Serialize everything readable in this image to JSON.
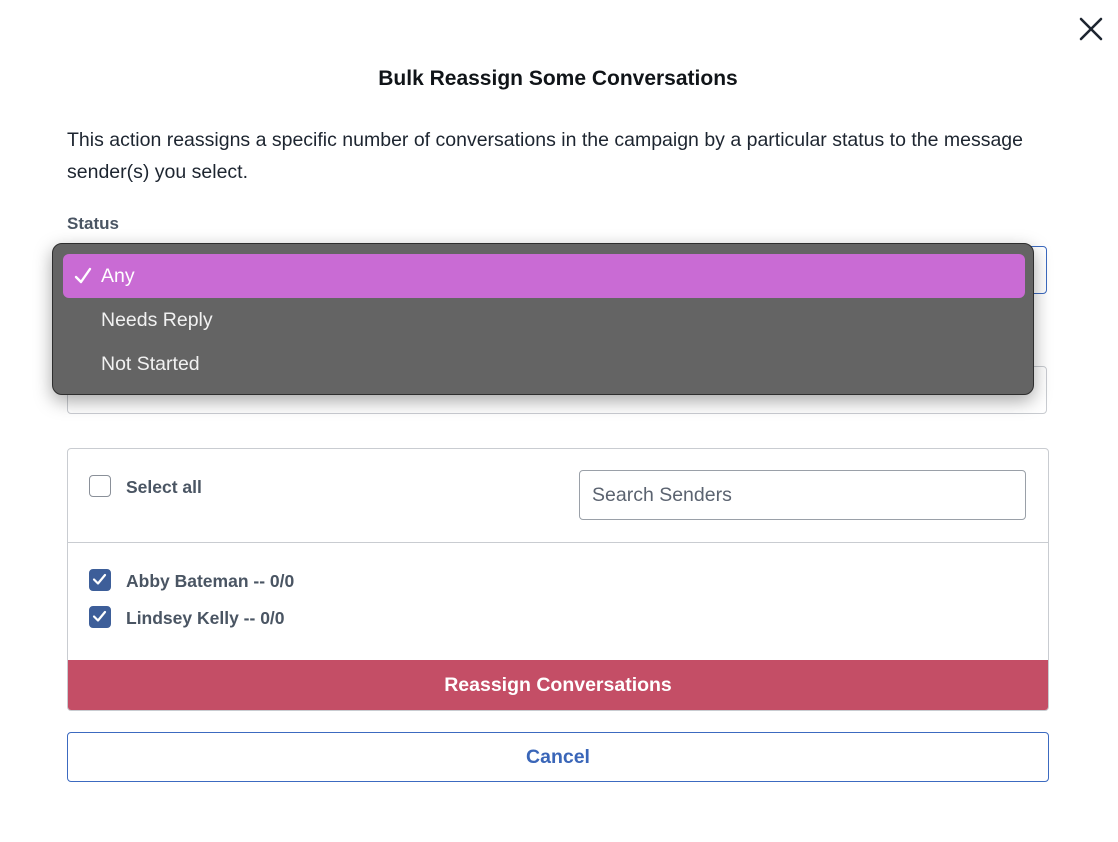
{
  "modal": {
    "title": "Bulk Reassign Some Conversations",
    "description": "This action reassigns a specific number of conversations in the campaign by a particular status to the message sender(s) you select.",
    "close_icon": "close-icon"
  },
  "status": {
    "label": "Status",
    "selected": "Any",
    "options": [
      {
        "label": "Any",
        "selected": true
      },
      {
        "label": "Needs Reply",
        "selected": false
      },
      {
        "label": "Not Started",
        "selected": false
      }
    ]
  },
  "senders": {
    "select_all_label": "Select all",
    "select_all_checked": false,
    "search_placeholder": "Search Senders",
    "search_value": "",
    "list": [
      {
        "label": "Abby Bateman -- 0/0",
        "checked": true
      },
      {
        "label": "Lindsey Kelly -- 0/0",
        "checked": true
      }
    ]
  },
  "actions": {
    "reassign_label": "Reassign Conversations",
    "cancel_label": "Cancel"
  },
  "colors": {
    "primary": "#3c6ac0",
    "reassign": "#c44e66",
    "dropdown_bg": "#646464",
    "dropdown_selected": "#c96bd4",
    "checkbox_checked": "#3d5e99"
  }
}
